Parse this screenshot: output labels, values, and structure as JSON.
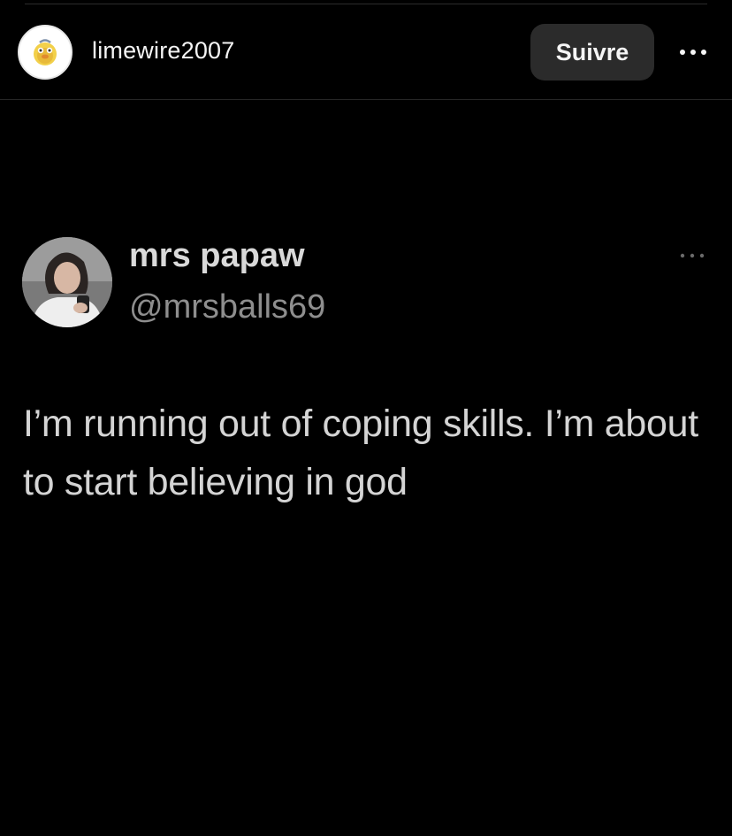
{
  "post_header": {
    "username": "limewire2007",
    "follow_label": "Suivre",
    "more_icon": "more-horizontal-icon"
  },
  "tweet": {
    "display_name": "mrs papaw",
    "handle": "@mrsballs69",
    "text": "I’m running out of coping skills. I’m about to start believing in god",
    "more_icon": "more-horizontal-icon"
  },
  "colors": {
    "background": "#000000",
    "button_bg": "#2b2b2b",
    "text_primary": "#f5f5f5",
    "tweet_text": "#d4d4d4",
    "handle": "#8e8e8e"
  }
}
